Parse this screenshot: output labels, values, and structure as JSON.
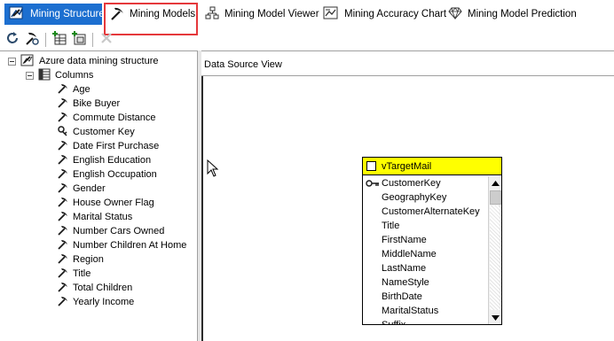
{
  "tabs": [
    {
      "label": "Mining Structure",
      "icon": "mining-structure-icon"
    },
    {
      "label": "Mining Models",
      "icon": "pickaxe-icon"
    },
    {
      "label": "Mining Model Viewer",
      "icon": "model-viewer-icon"
    },
    {
      "label": "Mining Accuracy Chart",
      "icon": "accuracy-chart-icon"
    },
    {
      "label": "Mining Model Prediction",
      "icon": "prediction-diamond-icon"
    }
  ],
  "toolbar": [
    {
      "icon": "refresh-icon"
    },
    {
      "icon": "process-icon"
    },
    {
      "icon": "add-table-icon"
    },
    {
      "icon": "add-nested-table-icon"
    },
    {
      "icon": "delete-icon"
    }
  ],
  "tree": {
    "root_label": "Azure data mining structure",
    "columns_label": "Columns",
    "columns": [
      {
        "label": "Age",
        "icon": "column-icon"
      },
      {
        "label": "Bike Buyer",
        "icon": "column-icon"
      },
      {
        "label": "Commute Distance",
        "icon": "column-icon"
      },
      {
        "label": "Customer Key",
        "icon": "key-icon"
      },
      {
        "label": "Date First Purchase",
        "icon": "column-icon"
      },
      {
        "label": "English Education",
        "icon": "column-icon"
      },
      {
        "label": "English Occupation",
        "icon": "column-icon"
      },
      {
        "label": "Gender",
        "icon": "column-icon"
      },
      {
        "label": "House Owner Flag",
        "icon": "column-icon"
      },
      {
        "label": "Marital Status",
        "icon": "column-icon"
      },
      {
        "label": "Number Cars Owned",
        "icon": "column-icon"
      },
      {
        "label": "Number Children At Home",
        "icon": "column-icon"
      },
      {
        "label": "Region",
        "icon": "column-icon"
      },
      {
        "label": "Title",
        "icon": "column-icon"
      },
      {
        "label": "Total Children",
        "icon": "column-icon"
      },
      {
        "label": "Yearly Income",
        "icon": "column-icon"
      }
    ]
  },
  "dsv": {
    "header": "Data Source View",
    "table": {
      "name": "vTargetMail",
      "columns": [
        "CustomerKey",
        "GeographyKey",
        "CustomerAlternateKey",
        "Title",
        "FirstName",
        "MiddleName",
        "LastName",
        "NameStyle",
        "BirthDate",
        "MaritalStatus",
        "Suffix"
      ]
    }
  },
  "colors": {
    "active_tab": "#1c6fd0",
    "highlight": "#e5383b",
    "table_title": "#ffff00"
  }
}
